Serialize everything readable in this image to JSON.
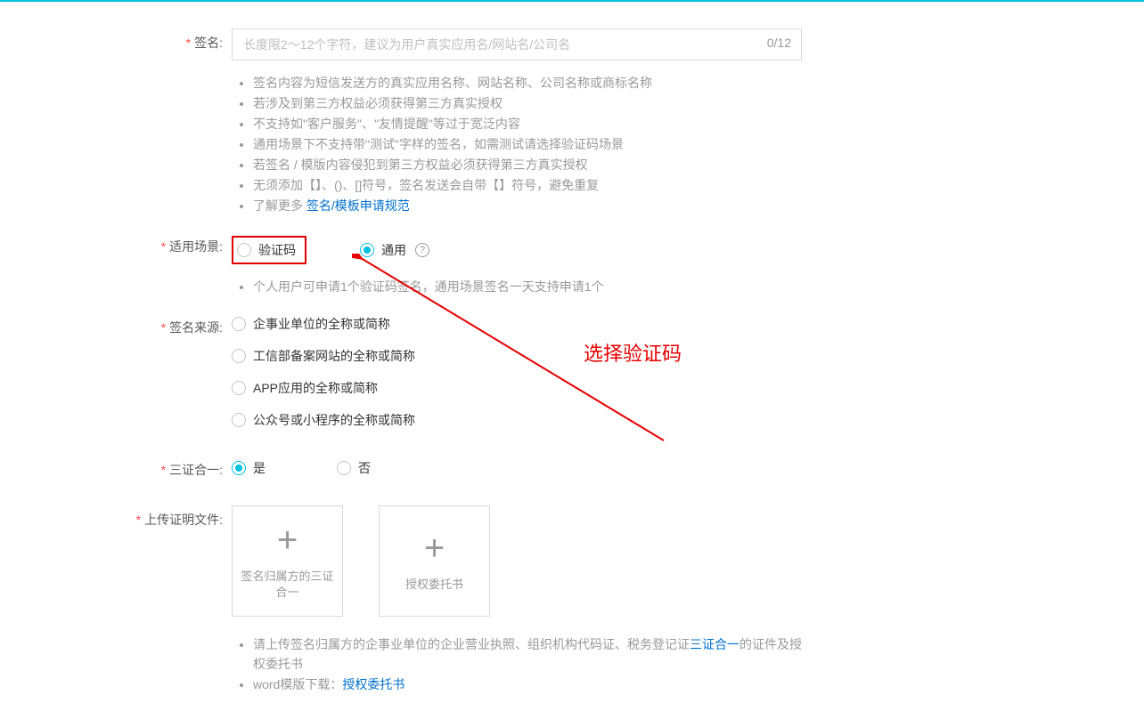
{
  "labels": {
    "signature": "签名:",
    "scene": "适用场景:",
    "source": "签名来源:",
    "threeCert": "三证合一:",
    "uploadFiles": "上传证明文件:"
  },
  "signature": {
    "placeholder": "长度限2～12个字符，建议为用户真实应用名/网站名/公司名",
    "value": "",
    "counter": "0/12"
  },
  "hints": {
    "signature": [
      "签名内容为短信发送方的真实应用名称、网站名称、公司名称或商标名称",
      "若涉及到第三方权益必须获得第三方真实授权",
      "不支持如\"客户服务\"、\"友情提醒\"等过于宽泛内容",
      "通用场景下不支持带\"测试\"字样的签名，如需测试请选择验证码场景",
      "若签名 / 模版内容侵犯到第三方权益必须获得第三方真实授权",
      "无须添加【】、()、[]符号，签名发送会自带【】符号，避免重复"
    ],
    "learnMorePrefix": "了解更多 ",
    "learnMoreLink": "签名/模板申请规范",
    "sceneHint": "个人用户可申请1个验证码签名，通用场景签名一天支持申请1个",
    "uploadPrefix": "请上传签名归属方的企事业单位的企业营业执照、组织机构代码证、税务登记证",
    "uploadLink": "三证合一",
    "uploadSuffix": "的证件及授权委托书",
    "wordTemplate": "word模版下载：",
    "wordTemplateLink": "授权委托书"
  },
  "scene": {
    "option1": "验证码",
    "option2": "通用"
  },
  "source": {
    "opt1": "企事业单位的全称或简称",
    "opt2": "工信部备案网站的全称或简称",
    "opt3": "APP应用的全称或简称",
    "opt4": "公众号或小程序的全称或简称"
  },
  "threeCert": {
    "yes": "是",
    "no": "否"
  },
  "upload": {
    "box1": "签名归属方的三证合一",
    "box2": "授权委托书"
  },
  "annotation": {
    "text": "选择验证码"
  }
}
